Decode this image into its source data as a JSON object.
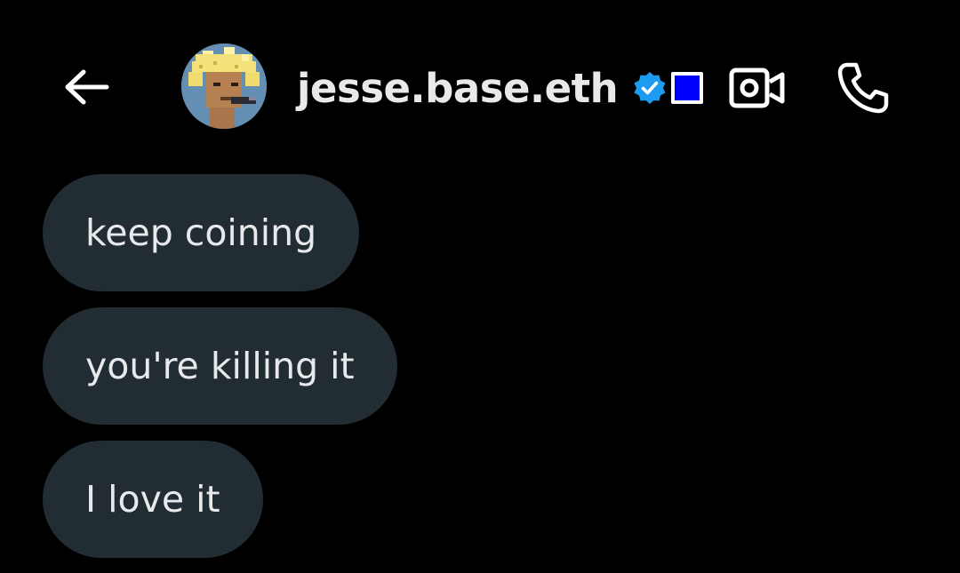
{
  "header": {
    "back_icon": "arrow-left-icon",
    "avatar_icon": "pixel-punk-avatar",
    "title": "jesse.base.eth",
    "verified_icon": "verified-badge-icon",
    "verified_color": "#1d9bf0",
    "affiliate_badge_color": "#0000ff",
    "video_icon": "video-camera-icon",
    "call_icon": "phone-icon"
  },
  "messages": [
    {
      "text": "keep coining"
    },
    {
      "text": "you're killing it"
    },
    {
      "text": "I love it"
    }
  ],
  "colors": {
    "background": "#000000",
    "bubble": "#222c33",
    "text": "#e7e9ea"
  }
}
